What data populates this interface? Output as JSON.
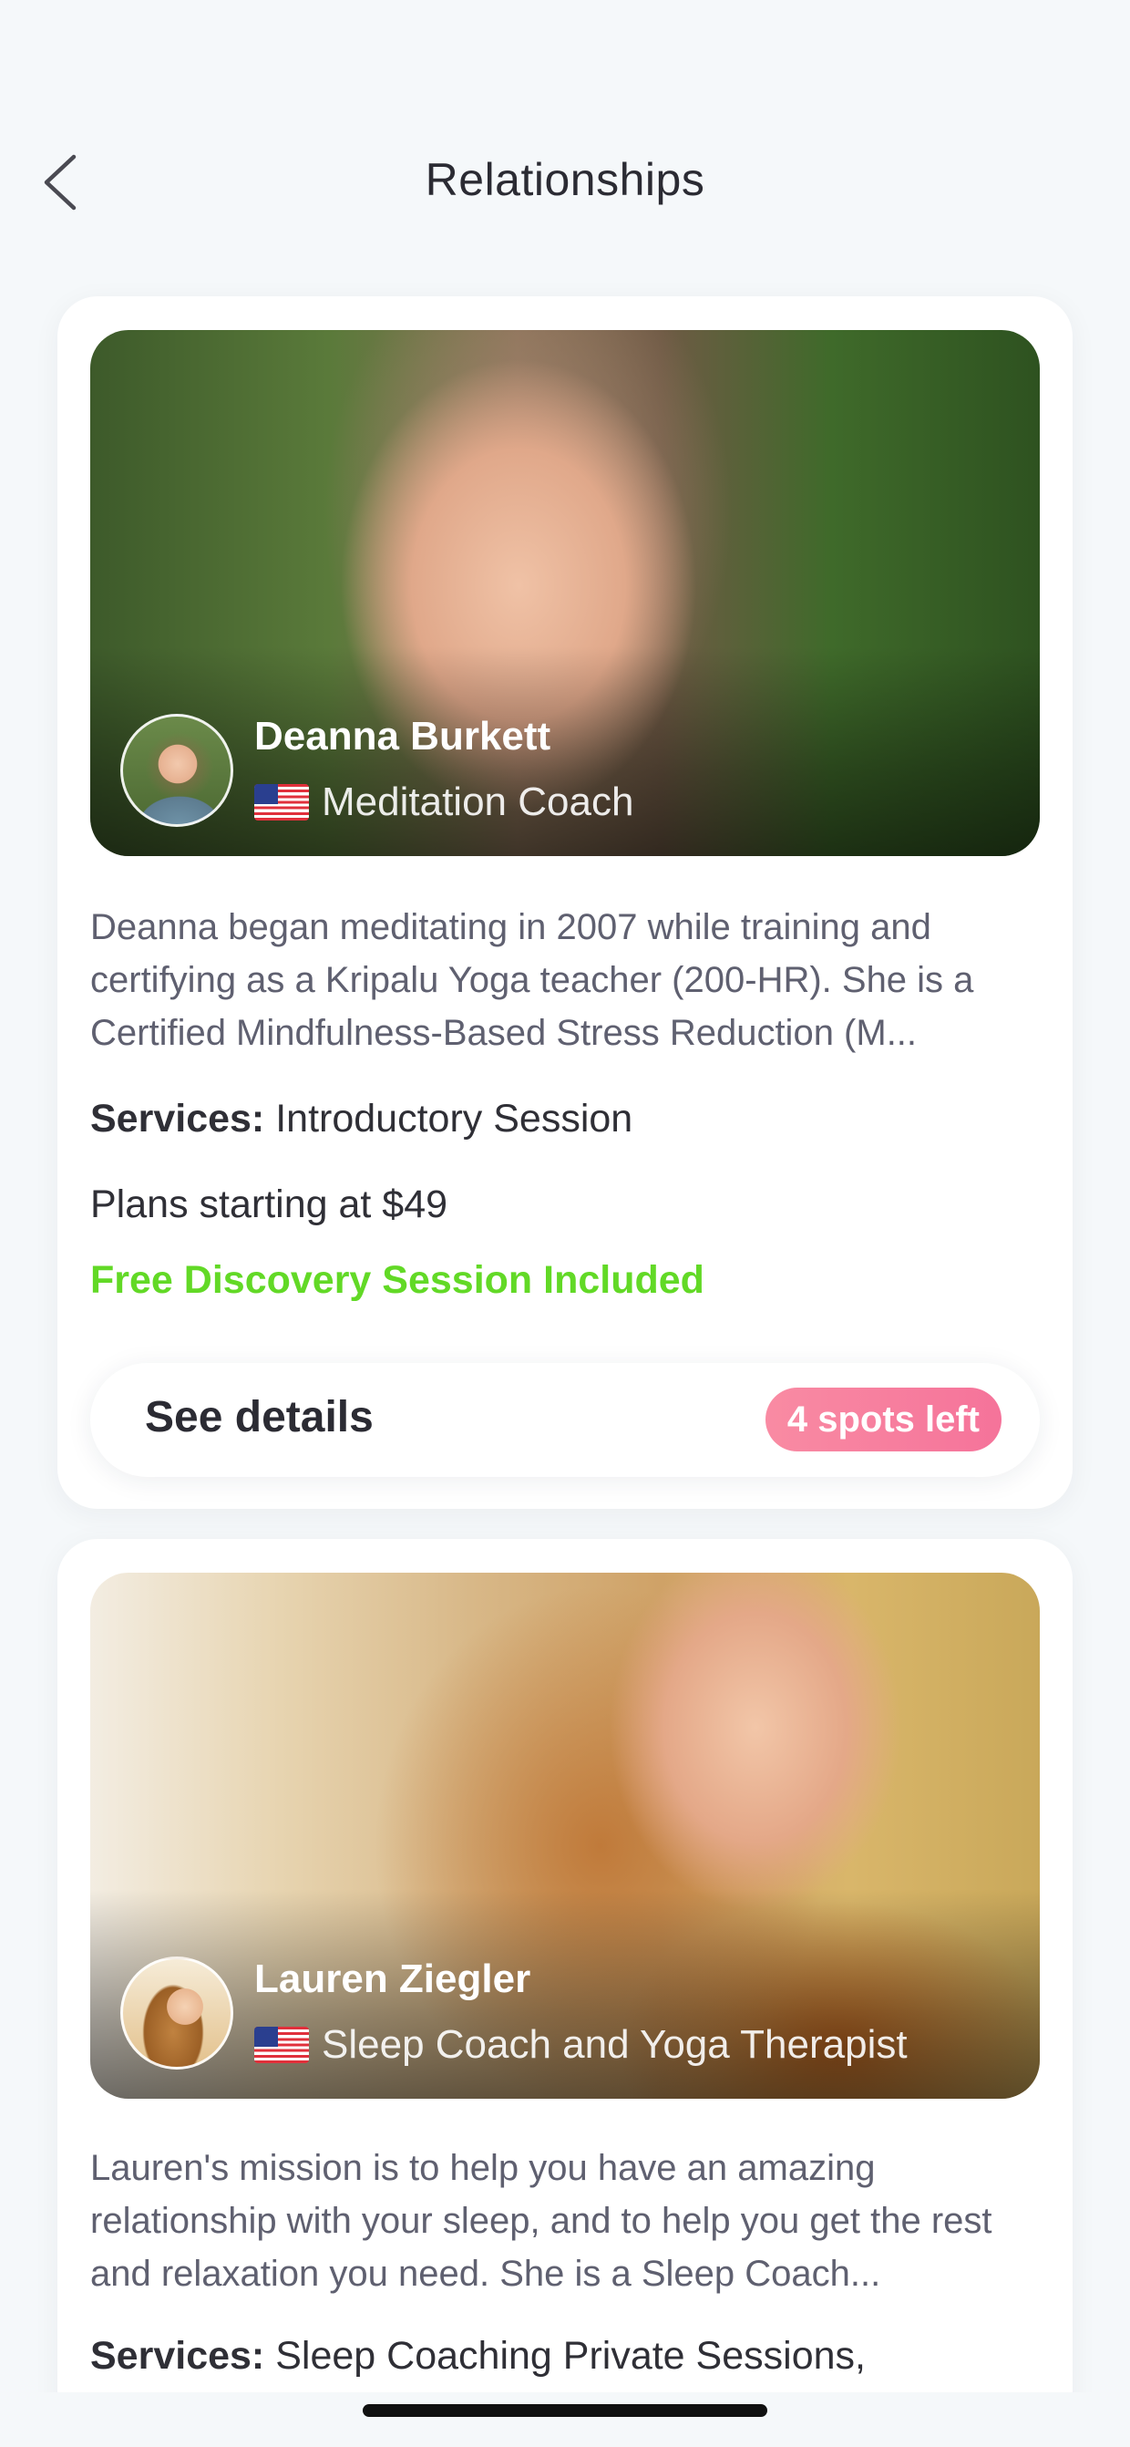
{
  "header": {
    "title": "Relationships",
    "back_icon": "chevron-left-icon"
  },
  "coaches": [
    {
      "name": "Deanna Burkett",
      "flag": "us-flag-icon",
      "role": "Meditation Coach",
      "description": "Deanna began meditating in 2007 while training and certifying as a Kripalu Yoga teacher (200-HR). She is a Certified Mindfulness-Based Stress Reduction (M...",
      "services_label": "Services:",
      "services_value": "Introductory Session",
      "plans": "Plans starting at $49",
      "free_session": "Free Discovery Session Included",
      "details_button": "See details",
      "spots_badge": "4 spots left"
    },
    {
      "name": "Lauren Ziegler",
      "flag": "us-flag-icon",
      "role": "Sleep Coach and Yoga Therapist",
      "description": "Lauren's mission is to help you have an amazing relationship with your sleep, and to help you get the rest and relaxation you need. She is a Sleep Coach...",
      "services_label": "Services:",
      "services_value": "Sleep Coaching Private Sessions,"
    }
  ],
  "colors": {
    "background": "#f5f8fa",
    "card": "#ffffff",
    "free_session_green": "#62d926",
    "badge_pink": "#f5739a",
    "text_dark": "#2f2f36",
    "text_muted": "#5f6070"
  }
}
